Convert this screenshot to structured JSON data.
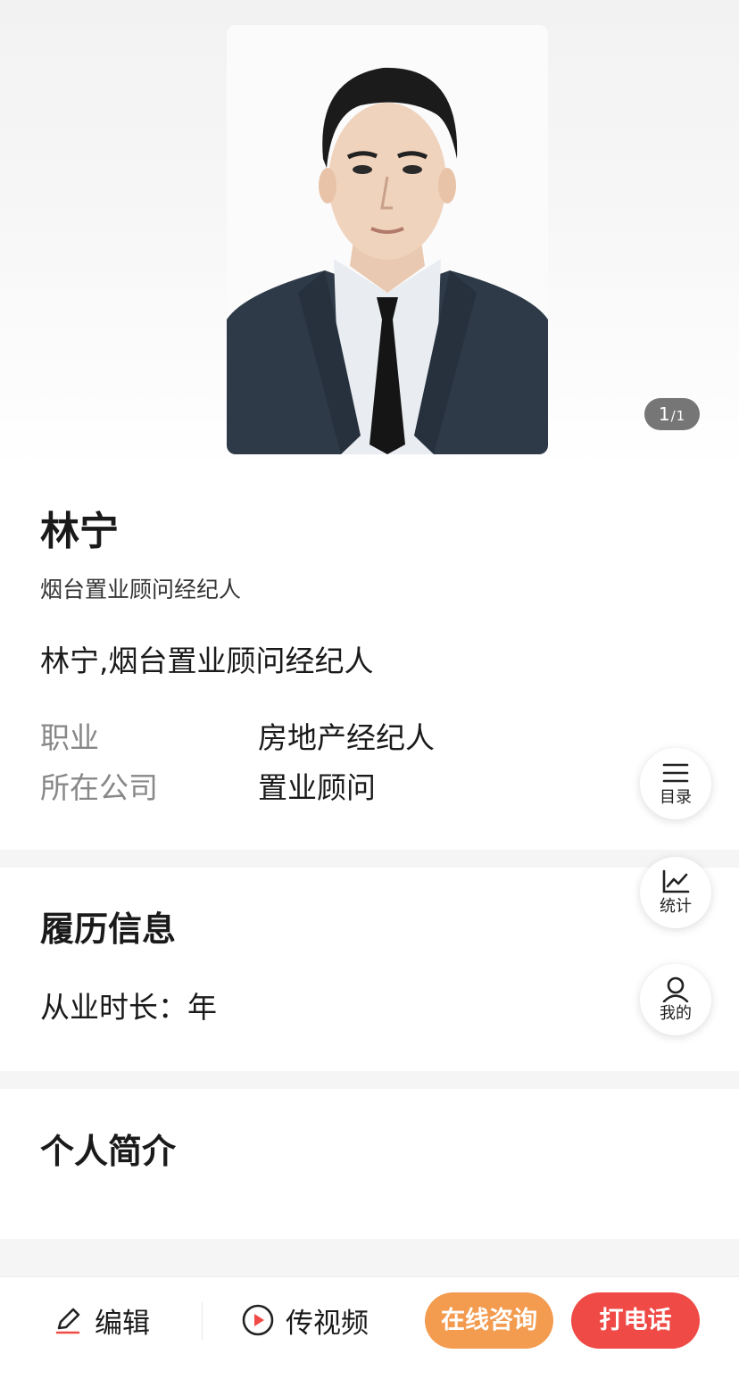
{
  "gallery": {
    "counter_current": "1",
    "counter_sep": "/",
    "counter_total": "1"
  },
  "profile": {
    "name": "林宁",
    "subtitle": "烟台置业顾问经纪人",
    "headline": "林宁,烟台置业顾问经纪人",
    "fields": [
      {
        "label": "职业",
        "value": "房地产经纪人"
      },
      {
        "label": "所在公司",
        "value": "置业顾问"
      }
    ]
  },
  "resume": {
    "title": "履历信息",
    "experience_label": "从业时长：",
    "experience_value": "年"
  },
  "intro": {
    "title": "个人简介"
  },
  "float_menu": [
    {
      "label": "目录",
      "icon": "menu-icon"
    },
    {
      "label": "统计",
      "icon": "chart-icon"
    },
    {
      "label": "我的",
      "icon": "user-icon"
    }
  ],
  "bottom_bar": {
    "edit_label": "编辑",
    "video_label": "传视频",
    "consult_label": "在线咨询",
    "call_label": "打电话"
  },
  "colors": {
    "consult": "#f39b4f",
    "call": "#ef4a45",
    "counter_bg": "#505050"
  }
}
